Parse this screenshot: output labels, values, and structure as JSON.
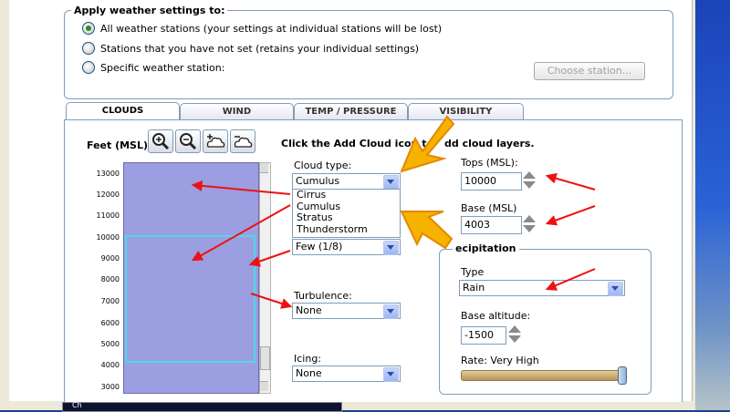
{
  "apply": {
    "title": "Apply weather settings to:",
    "options": [
      "All weather stations (your settings at individual stations will be lost)",
      "Stations that you have not set (retains your individual settings)",
      "Specific weather station:"
    ],
    "choose_button": "Choose station..."
  },
  "tabs": [
    "CLOUDS",
    "WIND",
    "TEMP / PRESSURE",
    "VISIBILITY"
  ],
  "clouds": {
    "feet_label": "Feet (MSL)",
    "instruction": "Click the Add Cloud icon t",
    "instruction_tail": "dd cloud layers.",
    "altitude_ticks": [
      "13000",
      "12000",
      "11000",
      "10000",
      "9000",
      "8000",
      "7000",
      "6000",
      "5000",
      "4000",
      "3000"
    ],
    "cloud_type_label": "Cloud type:",
    "cloud_type_value": "Cumulus",
    "cloud_type_options": [
      "Cirrus",
      "Cumulus",
      "Stratus",
      "Thunderstorm"
    ],
    "coverage_value": "Few (1/8)",
    "turbulence_label": "Turbulence:",
    "turbulence_value": "None",
    "icing_label": "Icing:",
    "icing_value": "None",
    "tops_label": "Tops (MSL):",
    "tops_value": "10000",
    "base_label": "Base (MSL)",
    "base_value": "4003",
    "precip_title": "ecipitation",
    "type_label": "Type",
    "type_value": "Rain",
    "base_altitude_label": "Base altitude:",
    "base_altitude_value": "-1500",
    "rate_label": "Rate: Very High",
    "rate_level": 1.0
  },
  "footer_text": "Ch"
}
